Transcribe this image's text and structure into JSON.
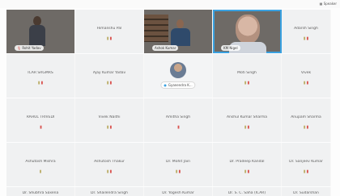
{
  "top_button": "Speaker",
  "tiles": [
    {
      "name": "Rohit Yadav",
      "label_only": true
    },
    {
      "name": "Himanshu Pal"
    },
    {
      "name": "Ashok Kumar",
      "label_only": true
    },
    {
      "name": "KM Nigel",
      "label_only": true
    },
    {
      "name": "Adarsh Singh"
    },
    {
      "name": "ICAR SRGMRS"
    },
    {
      "name": "Ajay Kumar Yadav"
    },
    {
      "name": "Gyanendra K..."
    },
    {
      "name": "Moti Singh"
    },
    {
      "name": "Vivek"
    },
    {
      "name": "RAHUL TRIVEDI"
    },
    {
      "name": "Vivek Naithi"
    },
    {
      "name": "Amitha Singh"
    },
    {
      "name": "Anshul Kumar Sharma"
    },
    {
      "name": "Anupam Sharma"
    },
    {
      "name": "Ashutosh Mishra"
    },
    {
      "name": "Ashutosh Thakur"
    },
    {
      "name": "Dr. Mohit Jain"
    },
    {
      "name": "Dr. Pradeep Kandal"
    },
    {
      "name": "Dr. Sanjeev Kumar"
    },
    {
      "name": "Dr. Shubhra Saxena"
    },
    {
      "name": "Dr. Shailendra Singh"
    },
    {
      "name": "Dr. Yogesh Kumar"
    },
    {
      "name": "Dr. S. C. Saha (ICAR)"
    },
    {
      "name": "Dr. Sudarshan"
    }
  ],
  "mic": {
    "level_glyph": "▮",
    "muted_glyph": "🎙"
  }
}
